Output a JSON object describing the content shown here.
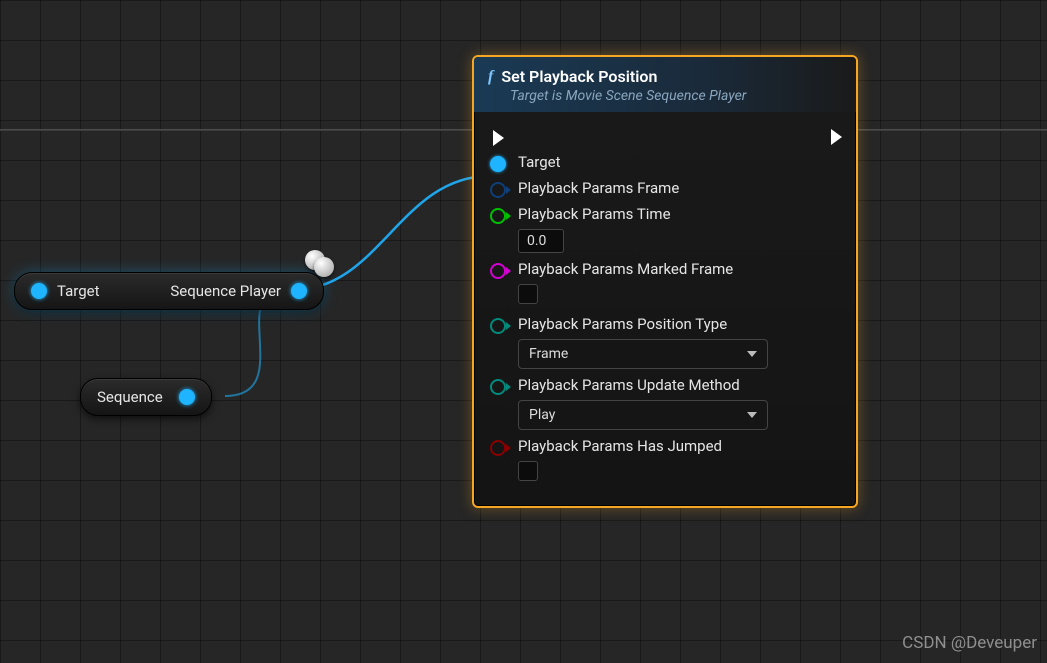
{
  "nodes": {
    "seqPlayer": {
      "input": "Target",
      "output": "Sequence Player"
    },
    "sequence": {
      "label": "Sequence"
    },
    "setPlayback": {
      "title": "Set Playback Position",
      "subtitle": "Target is Movie Scene Sequence Player",
      "pins": {
        "target": "Target",
        "frame": "Playback Params Frame",
        "time": "Playback Params Time",
        "markedFrame": "Playback Params Marked Frame",
        "positionType": "Playback Params Position Type",
        "updateMethod": "Playback Params Update Method",
        "hasJumped": "Playback Params Has Jumped"
      },
      "values": {
        "time": "0.0",
        "positionType": "Frame",
        "updateMethod": "Play"
      }
    }
  },
  "watermark": "CSDN @Deveuper"
}
